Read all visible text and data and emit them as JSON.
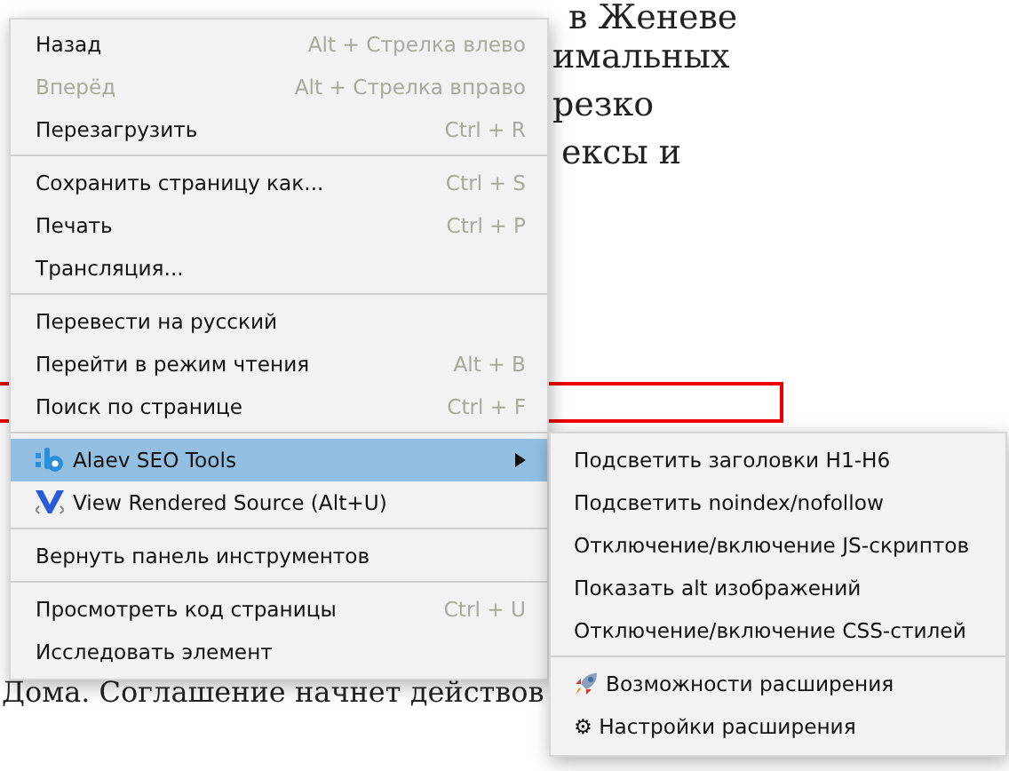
{
  "article": {
    "fragments": [
      {
        "kind": "text",
        "text": "в Женеве"
      },
      {
        "kind": "text",
        "text": "имальных"
      },
      {
        "kind": "text",
        "text": "резко"
      },
      {
        "kind": "text",
        "text": "ексы и"
      },
      {
        "kind": "text",
        "text": "Дома. Соглашение начнет действов"
      }
    ]
  },
  "context_menu": {
    "items": [
      {
        "kind": "item",
        "label": "Назад",
        "shortcut": "Alt + Стрелка влево",
        "disabled": false,
        "selected": false
      },
      {
        "kind": "item",
        "label": "Вперёд",
        "shortcut": "Alt + Стрелка вправо",
        "disabled": true,
        "selected": false
      },
      {
        "kind": "item",
        "label": "Перезагрузить",
        "shortcut": "Ctrl + R",
        "disabled": false,
        "selected": false
      },
      {
        "kind": "separator"
      },
      {
        "kind": "item",
        "label": "Сохранить страницу как...",
        "shortcut": "Ctrl + S",
        "disabled": false,
        "selected": false
      },
      {
        "kind": "item",
        "label": "Печать",
        "shortcut": "Ctrl + P",
        "disabled": false,
        "selected": false
      },
      {
        "kind": "item",
        "label": "Трансляция...",
        "disabled": false,
        "selected": false
      },
      {
        "kind": "separator"
      },
      {
        "kind": "item",
        "label": "Перевести на русский",
        "disabled": false,
        "selected": false
      },
      {
        "kind": "item",
        "label": "Перейти в режим чтения",
        "shortcut": "Alt + B",
        "disabled": false,
        "selected": false
      },
      {
        "kind": "item",
        "label": "Поиск по странице",
        "shortcut": "Ctrl + F",
        "disabled": false,
        "selected": false
      },
      {
        "kind": "separator"
      },
      {
        "kind": "extension",
        "label": "Alaev SEO Tools",
        "submenu": true,
        "disabled": false,
        "selected": true
      },
      {
        "kind": "extension",
        "label": "View Rendered Source (Alt+U)",
        "submenu": false,
        "disabled": false,
        "selected": false
      },
      {
        "kind": "separator"
      },
      {
        "kind": "item",
        "label": "Вернуть панель инструментов",
        "disabled": false,
        "selected": false
      },
      {
        "kind": "separator"
      },
      {
        "kind": "item",
        "label": "Просмотреть код страницы",
        "shortcut": "Ctrl + U",
        "disabled": false,
        "selected": false
      },
      {
        "kind": "item",
        "label": "Исследовать элемент",
        "disabled": false,
        "selected": false
      }
    ]
  },
  "submenu": {
    "items": [
      {
        "kind": "item",
        "label": "Подсветить заголовки H1-H6"
      },
      {
        "kind": "item",
        "label": "Подсветить noindex/nofollow"
      },
      {
        "kind": "item",
        "label": "Отключение/включение JS-скриптов"
      },
      {
        "kind": "item",
        "label": "Показать alt изображений"
      },
      {
        "kind": "item",
        "label": "Отключение/включение CSS-стилей"
      },
      {
        "kind": "separator"
      },
      {
        "kind": "rocket",
        "label": "Возможности расширения"
      },
      {
        "kind": "item",
        "label": "⚙ Настройки расширения"
      }
    ]
  }
}
